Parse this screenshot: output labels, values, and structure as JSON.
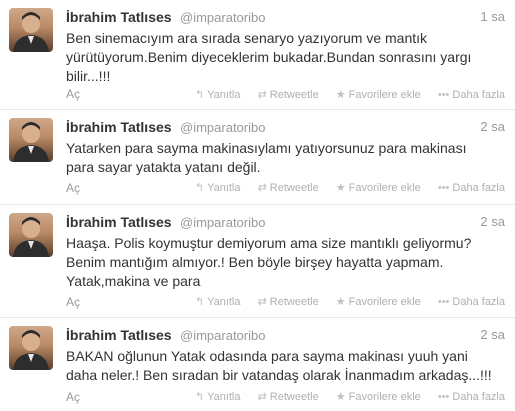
{
  "tweets": [
    {
      "name": "İbrahim Tatlıses",
      "handle": "@imparatoribo",
      "time": "1 sa",
      "text": "Ben sinemacıyım ara sırada senaryo yazıyorum ve mantık\nyürütüyorum.Benim diyeceklerim bukadar.Bundan sonrasını yargı\nbilir...!!!",
      "open": "Aç"
    },
    {
      "name": "İbrahim Tatlıses",
      "handle": "@imparatoribo",
      "time": "2 sa",
      "text": "Yatarken para sayma makinasıylamı yatıyorsunuz para makinası\npara sayar yatakta yatanı değil.",
      "open": "Aç"
    },
    {
      "name": "İbrahim Tatlıses",
      "handle": "@imparatoribo",
      "time": "2 sa",
      "text": "Haaşa. Polis koymuştur demiyorum ama size mantıklı geliyormu?\nBenim mantığım almıyor.! Ben böyle birşey hayatta yapmam.\nYatak,makina ve para",
      "open": "Aç"
    },
    {
      "name": "İbrahim Tatlıses",
      "handle": "@imparatoribo",
      "time": "2 sa",
      "text": "BAKAN oğlunun Yatak odasında para sayma makinası yuuh yani\ndaha neler.! Ben sıradan bir vatandaş olarak İnanmadım arkadaş...!!!",
      "open": "Aç"
    }
  ],
  "actions": {
    "reply": "Yanıtla",
    "retweet": "Retweetle",
    "favorite": "Favorilere ekle",
    "more": "Daha fazla"
  },
  "icons": {
    "reply": "reply-arrow-icon",
    "retweet": "retweet-icon",
    "favorite": "star-icon",
    "more": "dots-icon"
  },
  "colors": {
    "text": "#333333",
    "muted": "#999999",
    "action": "#b0b0b0",
    "divider": "#e8e8e8"
  }
}
